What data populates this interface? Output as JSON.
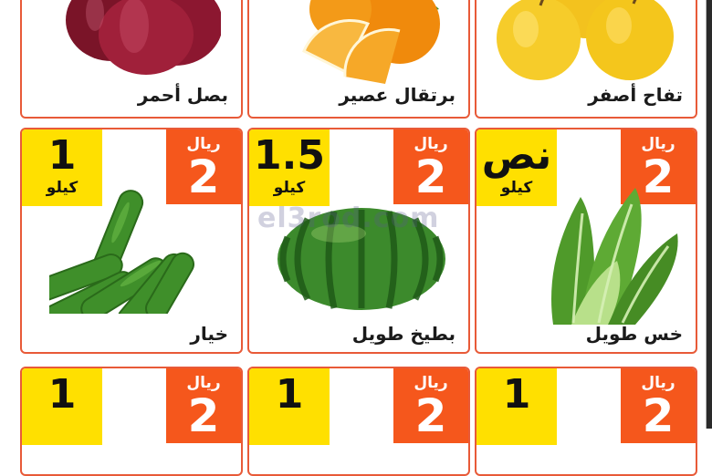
{
  "currency": "ريال",
  "watermark": "el3rod.com",
  "colors": {
    "price_bg": "#f5571c",
    "qty_bg": "#ffe000",
    "card_border": "#e85a38"
  },
  "row1": {
    "onion": {
      "name": "بصل أحمر",
      "icon": "red-onion-icon"
    },
    "orange": {
      "name": "برتقال عصير",
      "icon": "orange-icon"
    },
    "apple": {
      "name": "تفاح أصفر",
      "icon": "yellow-apple-icon"
    }
  },
  "row2": {
    "cucumber": {
      "name": "خيار",
      "price": "2",
      "qty": "1",
      "unit": "كيلو",
      "icon": "cucumber-icon"
    },
    "watermelon": {
      "name": "بطيخ طويل",
      "price": "2",
      "qty": "1.5",
      "unit": "كيلو",
      "icon": "watermelon-icon"
    },
    "lettuce": {
      "name": "خس طويل",
      "price": "2",
      "qty": "نص",
      "unit": "كيلو",
      "icon": "lettuce-icon"
    }
  },
  "row3": {
    "left": {
      "price": "2",
      "qty": "1"
    },
    "middle": {
      "price": "2",
      "qty": "1"
    },
    "right": {
      "price": "2",
      "qty": "1"
    }
  }
}
